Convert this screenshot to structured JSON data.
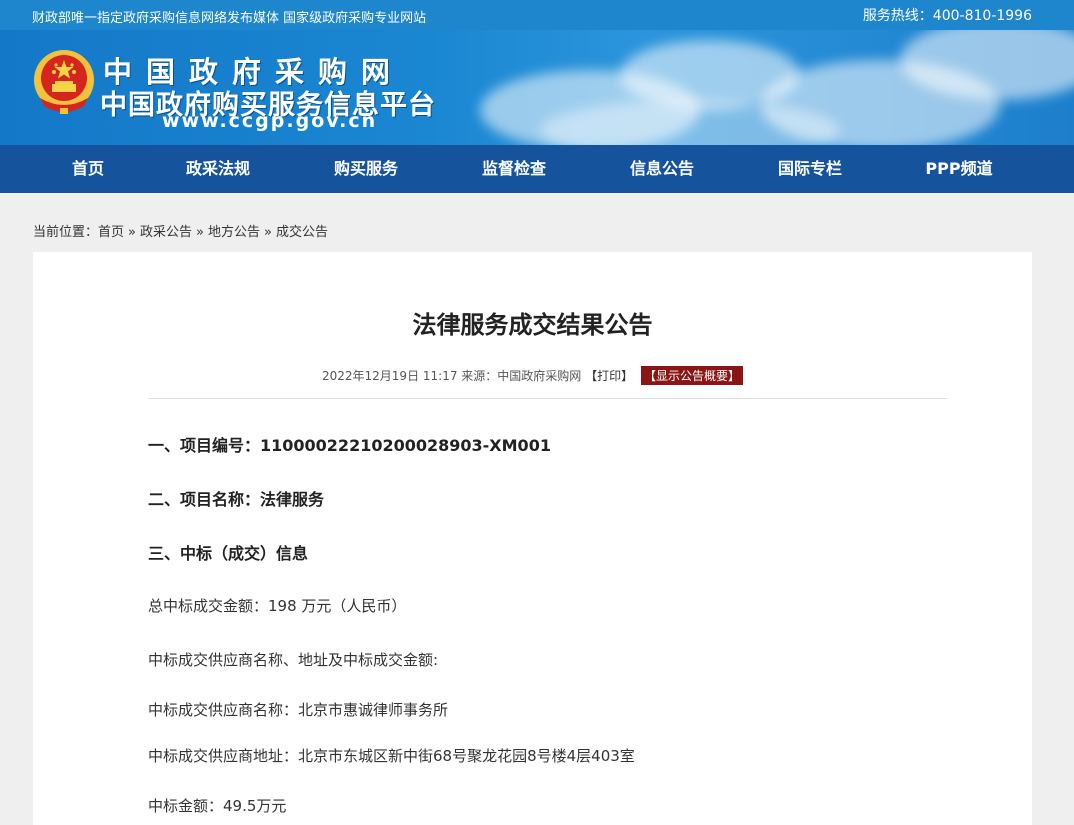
{
  "topbar": {
    "slogan": "财政部唯一指定政府采购信息网络发布媒体 国家级政府采购专业网站",
    "hotline": "服务热线：400-810-1996"
  },
  "brand": {
    "title": "中国政府采购网",
    "subtitle": "中国政府购买服务信息平台",
    "url": "www.ccgp.gov.cn",
    "emblem_icon": "national-emblem",
    "colors": {
      "primary": "#1e86cc",
      "nav": "#15549c",
      "accent": "#8b1414"
    }
  },
  "nav": {
    "items": [
      {
        "label": "首页"
      },
      {
        "label": "政采法规"
      },
      {
        "label": "购买服务"
      },
      {
        "label": "监督检查"
      },
      {
        "label": "信息公告"
      },
      {
        "label": "国际专栏"
      },
      {
        "label": "PPP频道"
      }
    ]
  },
  "breadcrumb": {
    "prefix": "当前位置：",
    "items": [
      "首页",
      "政采公告",
      "地方公告",
      "成交公告"
    ],
    "separator": "»"
  },
  "article": {
    "title": "法律服务成交结果公告",
    "datetime": "2022年12月19日 11:17",
    "source": "来源：中国政府采购网",
    "print_label": "【打印】",
    "summary_label": "【显示公告概要】",
    "lines": [
      "一、项目编号：11000022210200028903-XM001",
      "二、项目名称：法律服务",
      "三、中标（成交）信息",
      "总中标成交金额：198 万元（人民币）",
      "中标成交供应商名称、地址及中标成交金额:",
      "中标成交供应商名称：北京市惠诚律师事务所",
      "中标成交供应商地址：北京市东城区新中街68号聚龙花园8号楼4层403室",
      "中标金额：49.5万元"
    ]
  }
}
